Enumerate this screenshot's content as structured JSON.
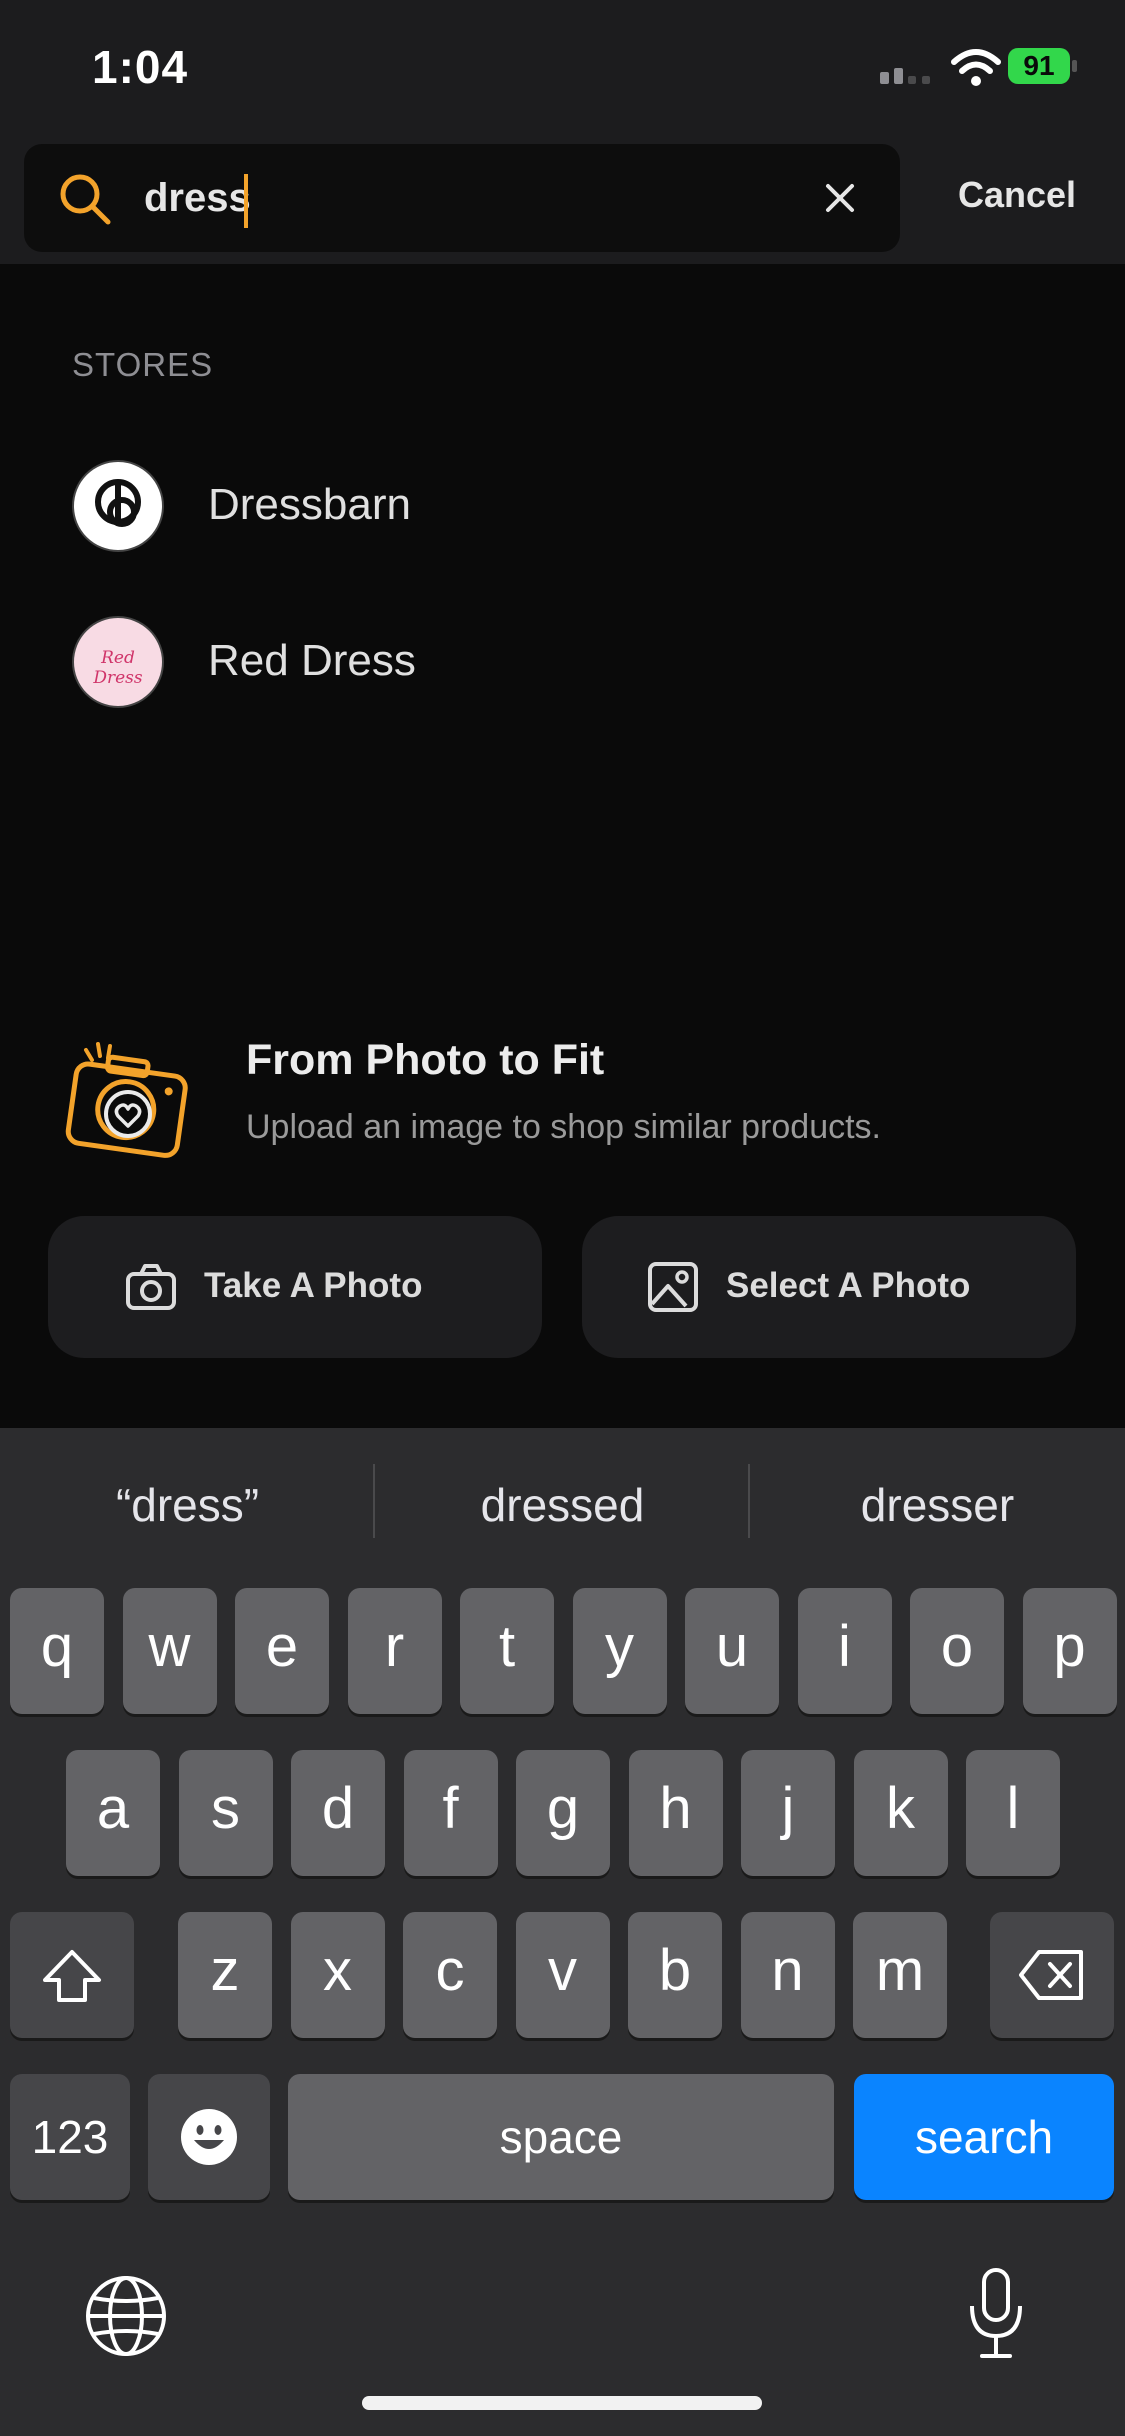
{
  "status_bar": {
    "time": "1:04",
    "battery": "91"
  },
  "search": {
    "query": "dress",
    "cancel_label": "Cancel"
  },
  "stores": {
    "heading": "STORES",
    "items": [
      {
        "name": "Dressbarn",
        "logo": "dressbarn-logo"
      },
      {
        "name": "Red Dress",
        "logo": "red-dress-logo",
        "logo_text": "Red Dress"
      }
    ]
  },
  "photo_feature": {
    "title": "From Photo to Fit",
    "subtitle": "Upload an image to shop similar products.",
    "take_label": "Take A Photo",
    "select_label": "Select A Photo"
  },
  "keyboard": {
    "suggestions": [
      "“dress”",
      "dressed",
      "dresser"
    ],
    "row1": [
      "q",
      "w",
      "e",
      "r",
      "t",
      "y",
      "u",
      "i",
      "o",
      "p"
    ],
    "row2": [
      "a",
      "s",
      "d",
      "f",
      "g",
      "h",
      "j",
      "k",
      "l"
    ],
    "row3": [
      "z",
      "x",
      "c",
      "v",
      "b",
      "n",
      "m"
    ],
    "numbers_label": "123",
    "space_label": "space",
    "search_label": "search"
  },
  "colors": {
    "accent": "#f3a32b",
    "search_key": "#0a84ff",
    "battery": "#32d74b"
  }
}
